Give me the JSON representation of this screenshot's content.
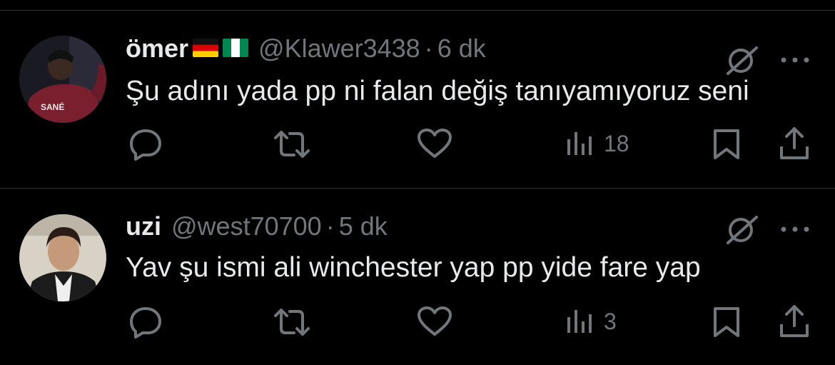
{
  "tweets": [
    {
      "display_name": "ömer",
      "flags": [
        "germany-flag",
        "nigeria-flag"
      ],
      "handle": "@Klawer3438",
      "separator": "·",
      "time": "6 dk",
      "text": "Şu adını yada pp ni falan değiş tanıyamıyoruz seni",
      "views": "18",
      "avatar_jersey_text": "SANÉ"
    },
    {
      "display_name": "uzi",
      "flags": [],
      "handle": "@west70700",
      "separator": "·",
      "time": "5 dk",
      "text": "Yav şu ismi ali winchester yap pp yide fare yap",
      "views": "3"
    }
  ],
  "icons": {
    "reply": "reply-icon",
    "retweet": "retweet-icon",
    "like": "heart-icon",
    "views": "views-icon",
    "bookmark": "bookmark-icon",
    "share": "share-icon",
    "grok": "grok-icon",
    "more": "more-icon"
  },
  "colors": {
    "background": "#000000",
    "primary_text": "#e7e9ea",
    "secondary_text": "#71767b",
    "divider": "#2f3336"
  }
}
